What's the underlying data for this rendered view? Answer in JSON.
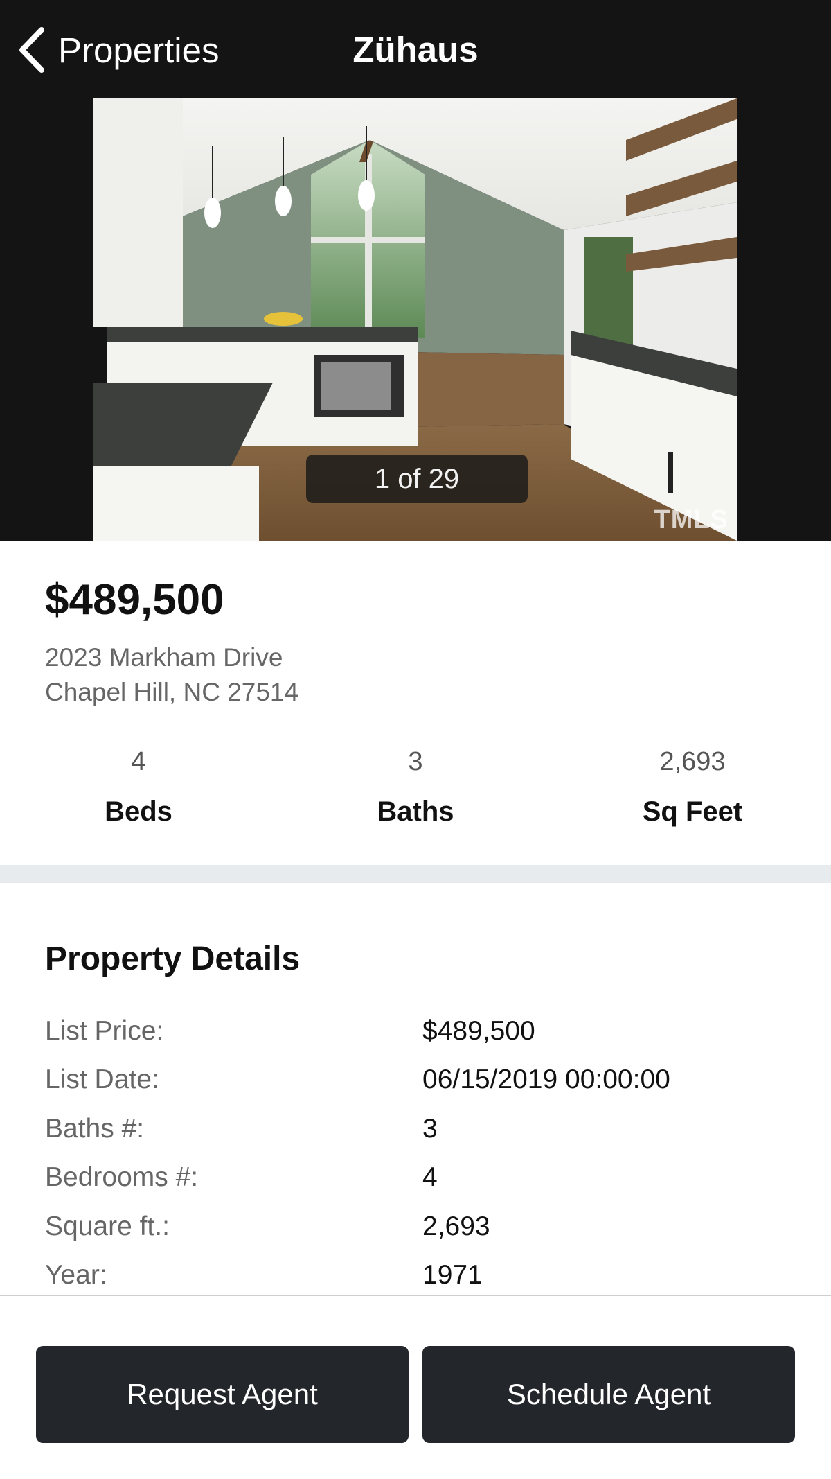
{
  "nav": {
    "back_label": "Properties",
    "title": "Zühaus"
  },
  "gallery": {
    "counter": "1 of 29",
    "watermark": "TMLS"
  },
  "listing": {
    "price": "$489,500",
    "address_line1": "2023 Markham Drive",
    "address_line2": "Chapel Hill, NC 27514",
    "stats": [
      {
        "value": "4",
        "label": "Beds"
      },
      {
        "value": "3",
        "label": "Baths"
      },
      {
        "value": "2,693",
        "label": "Sq Feet"
      }
    ]
  },
  "details": {
    "title": "Property Details",
    "rows": [
      {
        "key": "List Price:",
        "value": "$489,500"
      },
      {
        "key": "List Date:",
        "value": "06/15/2019 00:00:00"
      },
      {
        "key": "Baths #:",
        "value": "3"
      },
      {
        "key": "Bedrooms #:",
        "value": "4"
      },
      {
        "key": "Square ft.:",
        "value": "2,693"
      },
      {
        "key": "Year:",
        "value": "1971"
      }
    ]
  },
  "actions": {
    "request_label": "Request Agent",
    "schedule_label": "Schedule Agent"
  },
  "colors": {
    "nav_background": "#141414",
    "button_background": "#23262b",
    "separator": "#e8ebee"
  }
}
